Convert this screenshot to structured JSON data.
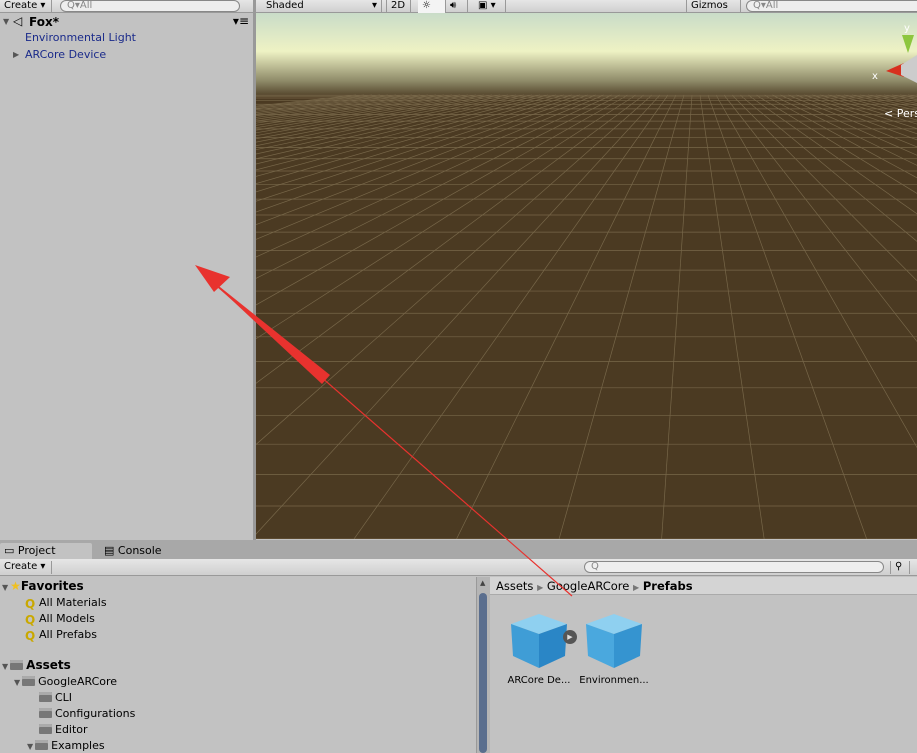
{
  "hierarchy": {
    "create_label": "Create",
    "search_placeholder": "All",
    "scene_name": "Fox*",
    "items": [
      {
        "label": "Environmental Light",
        "expandable": false
      },
      {
        "label": "ARCore Device",
        "expandable": true
      }
    ]
  },
  "scene": {
    "shading_mode": "Shaded",
    "mode_2d": "2D",
    "gizmos_label": "Gizmos",
    "search_placeholder": "All",
    "axis_y": "y",
    "axis_x": "x",
    "projection_label": "Persp"
  },
  "project": {
    "tabs": [
      {
        "label": "Project",
        "active": true
      },
      {
        "label": "Console",
        "active": false
      }
    ],
    "create_label": "Create",
    "favorites": {
      "label": "Favorites",
      "items": [
        "All Materials",
        "All Models",
        "All Prefabs"
      ]
    },
    "assets": {
      "label": "Assets",
      "children": [
        {
          "label": "GoogleARCore",
          "children": [
            "CLI",
            "Configurations",
            "Editor",
            "Examples"
          ]
        }
      ]
    },
    "breadcrumb": [
      "Assets",
      "GoogleARCore",
      "Prefabs"
    ],
    "files": [
      {
        "label": "ARCore De..."
      },
      {
        "label": "Environmen..."
      }
    ]
  },
  "colors": {
    "annotation_arrow": "#e8322e",
    "ground": "#4b3a22",
    "hierarchy_text": "#1a2a8a"
  }
}
